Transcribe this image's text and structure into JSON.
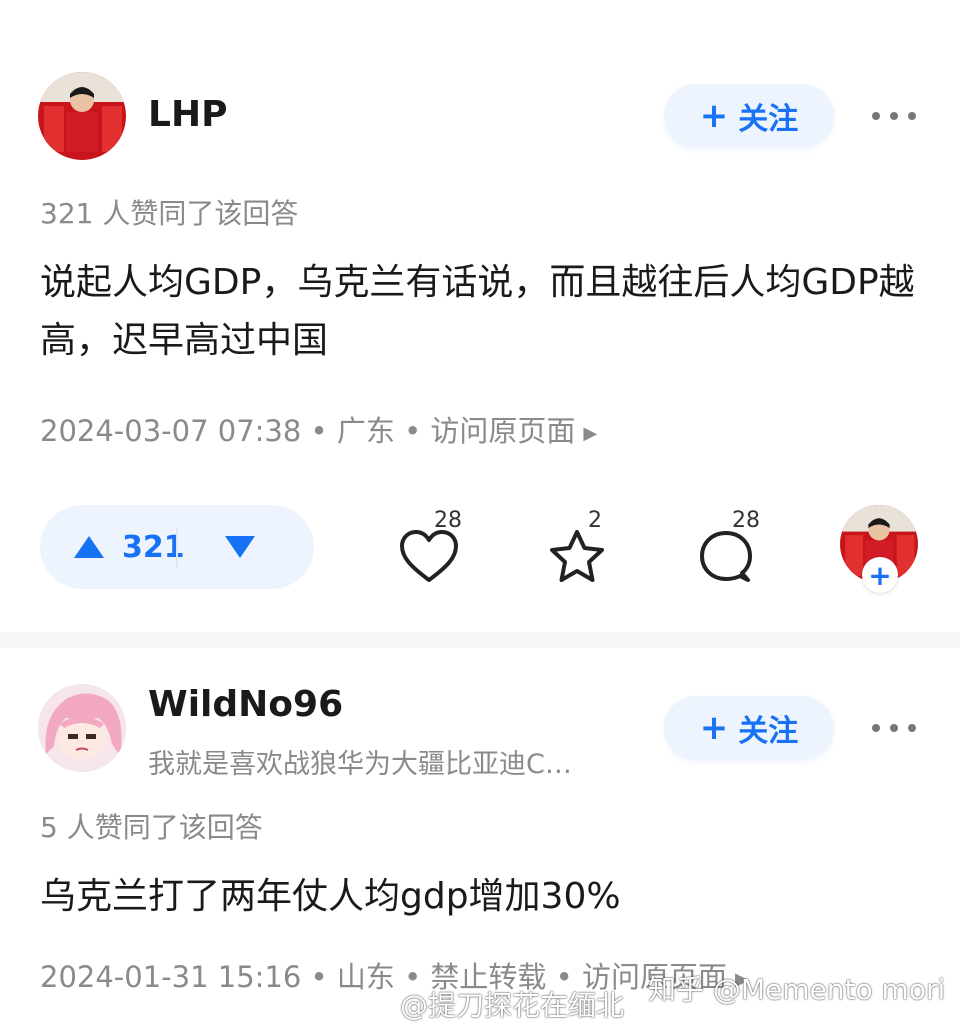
{
  "answer1": {
    "author": "LHP",
    "follow_label": "关注",
    "likes_text": "321 人赞同了该回答",
    "content": "说起人均GDP，乌克兰有话说，而且越往后人均GDP越高，迟早高过中国",
    "meta": "2024-03-07 07:38 • 广东 • 访问原页面",
    "vote_count": "321",
    "likes_count": "28",
    "favorites_count": "2",
    "comments_count": "28",
    "add_symbol": "+"
  },
  "answer2": {
    "author": "WildNo96",
    "bio": "我就是喜欢战狼华为大疆比亚迪C…",
    "follow_label": "关注",
    "likes_text": "5 人赞同了该回答",
    "content": "乌克兰打了两年仗人均gdp增加30%",
    "meta": "2024-01-31 15:16 • 山东 • 禁止转载 • 访问原页面"
  },
  "watermarks": {
    "weibo": "@提刀探花在缅北",
    "zhihu": "知乎 @Memento mori"
  },
  "colors": {
    "accent": "#1772f6",
    "follow_bg": "#eef4fd",
    "muted_text": "#8a8a8a"
  },
  "icons": [
    "plus-icon",
    "more-icon",
    "upvote-icon",
    "downvote-icon",
    "heart-icon",
    "star-icon",
    "comment-icon",
    "avatar"
  ]
}
